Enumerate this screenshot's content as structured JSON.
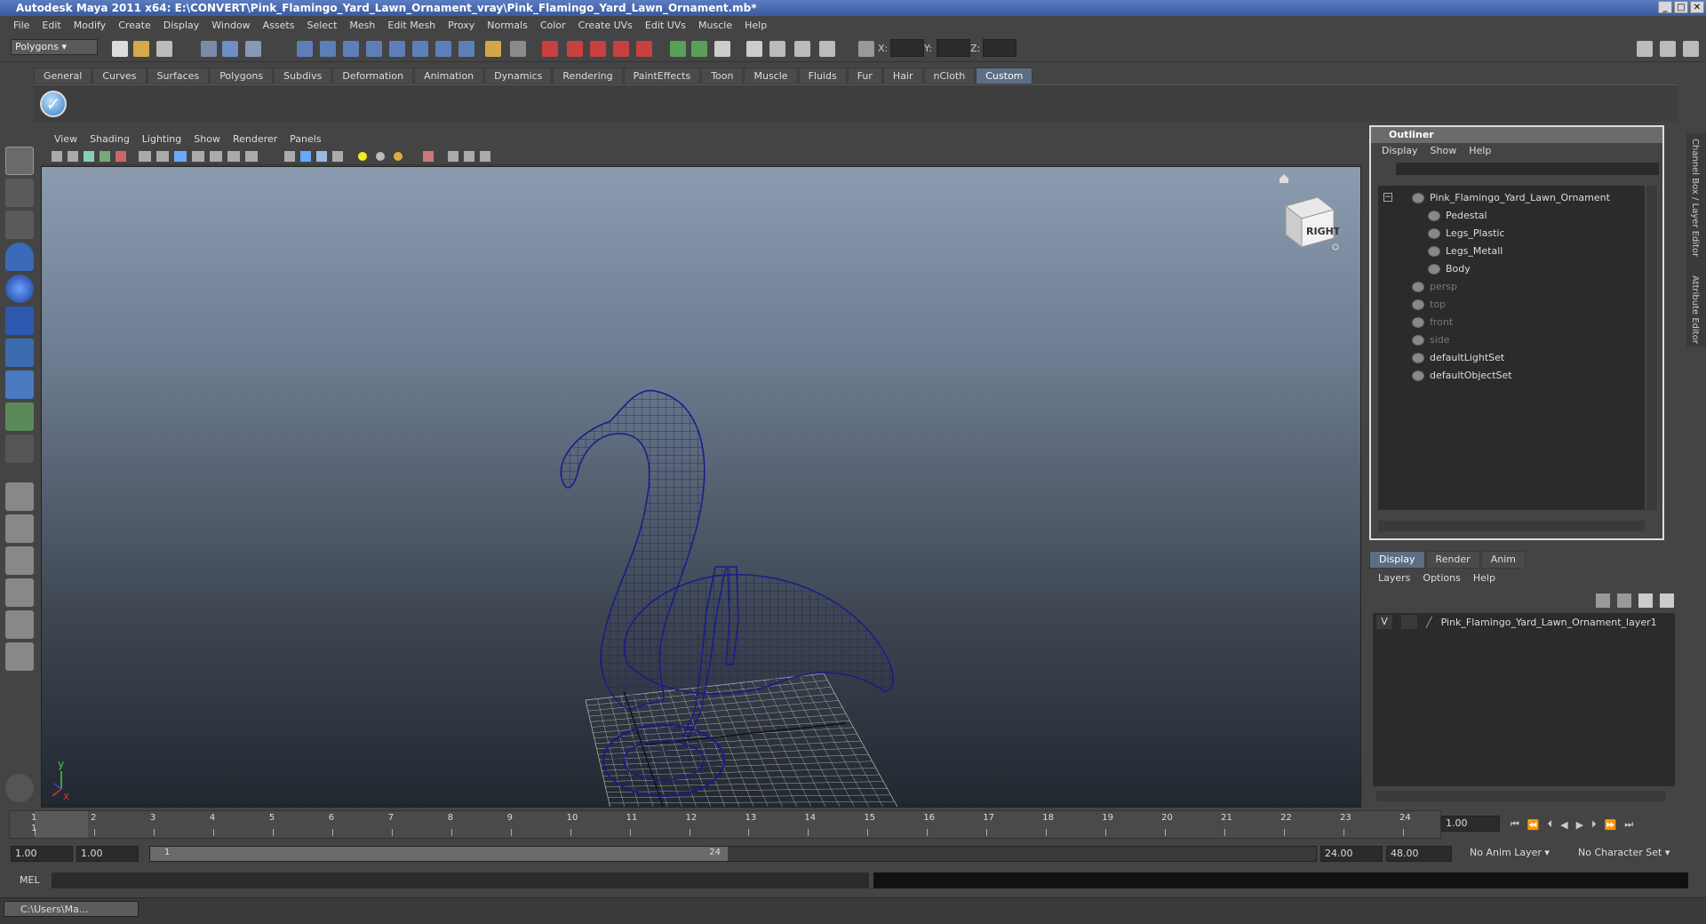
{
  "window": {
    "title": "Autodesk Maya 2011 x64: E:\\CONVERT\\Pink_Flamingo_Yard_Lawn_Ornament_vray\\Pink_Flamingo_Yard_Lawn_Ornament.mb*"
  },
  "menubar": [
    "File",
    "Edit",
    "Modify",
    "Create",
    "Display",
    "Window",
    "Assets",
    "Select",
    "Mesh",
    "Edit Mesh",
    "Proxy",
    "Normals",
    "Color",
    "Create UVs",
    "Edit UVs",
    "Muscle",
    "Help"
  ],
  "toolbar": {
    "mode": "Polygons",
    "x_label": "X:",
    "y_label": "Y:",
    "z_label": "Z:"
  },
  "shelf_tabs": [
    "General",
    "Curves",
    "Surfaces",
    "Polygons",
    "Subdivs",
    "Deformation",
    "Animation",
    "Dynamics",
    "Rendering",
    "PaintEffects",
    "Toon",
    "Muscle",
    "Fluids",
    "Fur",
    "Hair",
    "nCloth",
    "Custom"
  ],
  "shelf_active": "Custom",
  "viewport": {
    "menu": [
      "View",
      "Shading",
      "Lighting",
      "Show",
      "Renderer",
      "Panels"
    ],
    "viewcube_label": "RIGHT",
    "axis_y": "y",
    "axis_x": "x",
    "wire_color": "#1a1a8a"
  },
  "outliner": {
    "title": "Outliner",
    "menu": [
      "Display",
      "Show",
      "Help"
    ],
    "items": [
      {
        "label": "Pink_Flamingo_Yard_Lawn_Ornament",
        "level": 0,
        "dim": false
      },
      {
        "label": "Pedestal",
        "level": 1,
        "dim": false
      },
      {
        "label": "Legs_Plastic",
        "level": 1,
        "dim": false
      },
      {
        "label": "Legs_Metall",
        "level": 1,
        "dim": false
      },
      {
        "label": "Body",
        "level": 1,
        "dim": false
      },
      {
        "label": "persp",
        "level": 0,
        "dim": true
      },
      {
        "label": "top",
        "level": 0,
        "dim": true
      },
      {
        "label": "front",
        "level": 0,
        "dim": true
      },
      {
        "label": "side",
        "level": 0,
        "dim": true
      },
      {
        "label": "defaultLightSet",
        "level": 0,
        "dim": false
      },
      {
        "label": "defaultObjectSet",
        "level": 0,
        "dim": false
      }
    ]
  },
  "layer_editor": {
    "tabs": [
      "Display",
      "Render",
      "Anim"
    ],
    "active_tab": "Display",
    "menu": [
      "Layers",
      "Options",
      "Help"
    ],
    "layer_visible": "V",
    "layer_name": "Pink_Flamingo_Yard_Lawn_Ornament_layer1"
  },
  "side_tabs": [
    "Channel Box / Layer Editor",
    "Attribute Editor"
  ],
  "timeline": {
    "ticks": [
      "1",
      "2",
      "3",
      "4",
      "5",
      "6",
      "7",
      "8",
      "9",
      "10",
      "11",
      "12",
      "13",
      "14",
      "15",
      "16",
      "17",
      "18",
      "19",
      "20",
      "21",
      "22",
      "23",
      "24"
    ],
    "current_marker": "1",
    "current_frame": "1.00"
  },
  "range": {
    "start": "1.00",
    "start2": "1.00",
    "slider_start": "1",
    "slider_end": "24",
    "end": "24.00",
    "end2": "48.00",
    "anim_layer": "No Anim Layer",
    "char_set": "No Character Set"
  },
  "mel": {
    "label": "MEL"
  },
  "taskbar": {
    "item": "C:\\Users\\Ma..."
  }
}
